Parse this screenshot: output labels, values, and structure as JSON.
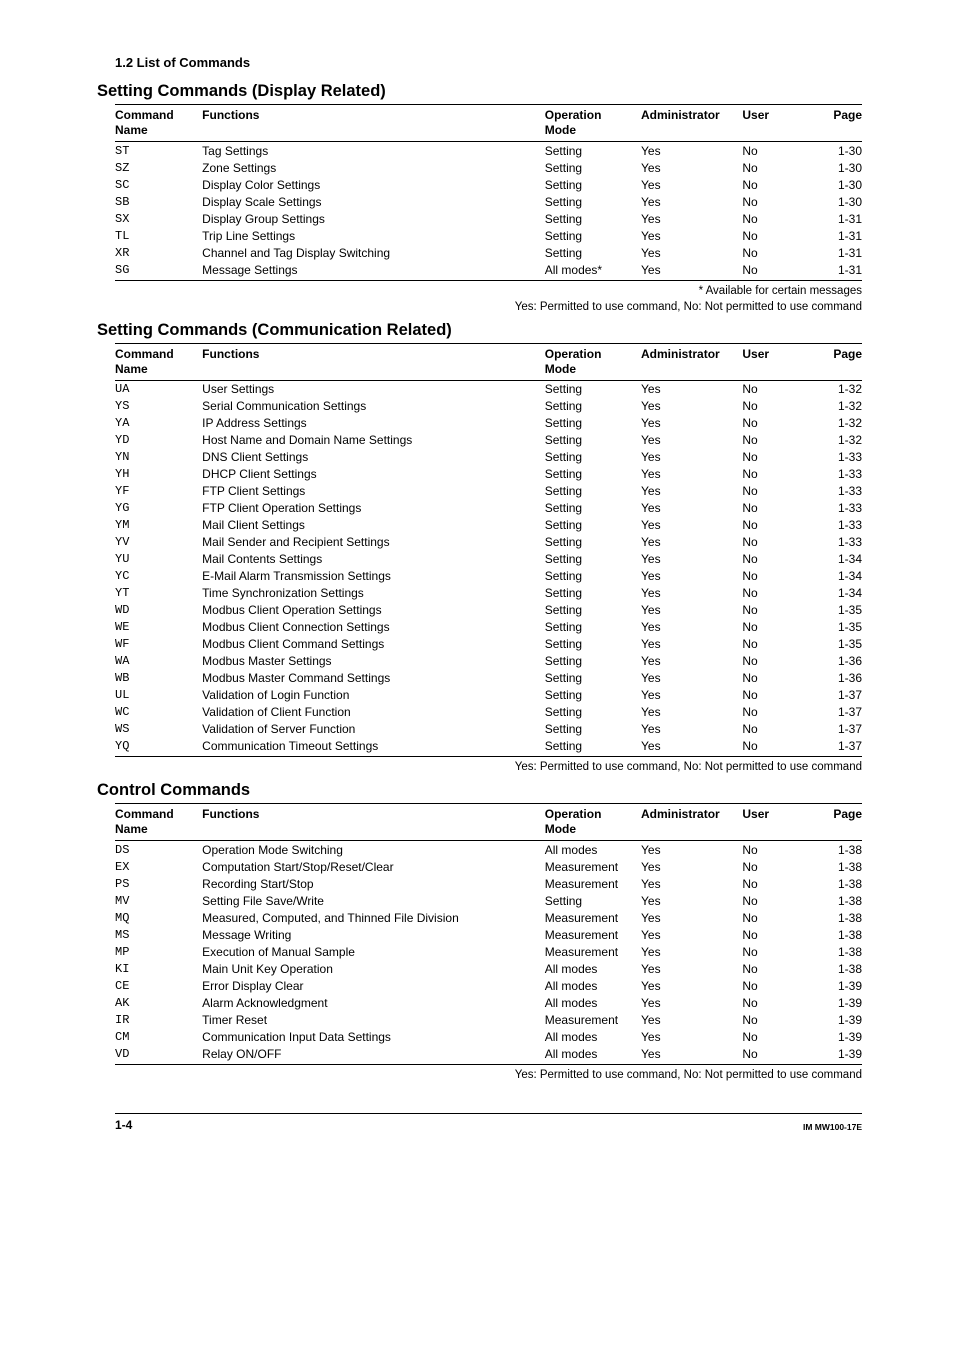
{
  "topHeading": "1.2  List of Commands",
  "sections": [
    {
      "title": "Setting Commands (Display Related)",
      "rows": [
        {
          "name": "ST",
          "func": "Tag Settings",
          "op": "Setting",
          "admin": "Yes",
          "user": "No",
          "page": "1-30"
        },
        {
          "name": "SZ",
          "func": "Zone Settings",
          "op": "Setting",
          "admin": "Yes",
          "user": "No",
          "page": "1-30"
        },
        {
          "name": "SC",
          "func": "Display Color Settings",
          "op": "Setting",
          "admin": "Yes",
          "user": "No",
          "page": "1-30"
        },
        {
          "name": "SB",
          "func": "Display Scale Settings",
          "op": "Setting",
          "admin": "Yes",
          "user": "No",
          "page": "1-30"
        },
        {
          "name": "SX",
          "func": "Display Group Settings",
          "op": "Setting",
          "admin": "Yes",
          "user": "No",
          "page": "1-31"
        },
        {
          "name": "TL",
          "func": "Trip Line Settings",
          "op": "Setting",
          "admin": "Yes",
          "user": "No",
          "page": "1-31"
        },
        {
          "name": "XR",
          "func": "Channel and Tag Display Switching",
          "op": "Setting",
          "admin": "Yes",
          "user": "No",
          "page": "1-31"
        },
        {
          "name": "SG",
          "func": "Message Settings",
          "op": "All modes*",
          "admin": "Yes",
          "user": "No",
          "page": "1-31"
        }
      ],
      "notes": [
        "* Available for certain messages",
        "Yes: Permitted to use command, No: Not permitted to use command"
      ]
    },
    {
      "title": "Setting Commands (Communication Related)",
      "rows": [
        {
          "name": "UA",
          "func": "User Settings",
          "op": "Setting",
          "admin": "Yes",
          "user": "No",
          "page": "1-32"
        },
        {
          "name": "YS",
          "func": "Serial Communication Settings",
          "op": "Setting",
          "admin": "Yes",
          "user": "No",
          "page": "1-32"
        },
        {
          "name": "YA",
          "func": "IP Address Settings",
          "op": "Setting",
          "admin": "Yes",
          "user": "No",
          "page": "1-32"
        },
        {
          "name": "YD",
          "func": "Host Name and Domain Name Settings",
          "op": "Setting",
          "admin": "Yes",
          "user": "No",
          "page": "1-32"
        },
        {
          "name": "YN",
          "func": "DNS Client Settings",
          "op": "Setting",
          "admin": "Yes",
          "user": "No",
          "page": "1-33"
        },
        {
          "name": "YH",
          "func": "DHCP Client Settings",
          "op": "Setting",
          "admin": "Yes",
          "user": "No",
          "page": "1-33"
        },
        {
          "name": "YF",
          "func": "FTP Client Settings",
          "op": "Setting",
          "admin": "Yes",
          "user": "No",
          "page": "1-33"
        },
        {
          "name": "YG",
          "func": "FTP Client Operation Settings",
          "op": "Setting",
          "admin": "Yes",
          "user": "No",
          "page": "1-33"
        },
        {
          "name": "YM",
          "func": "Mail Client Settings",
          "op": "Setting",
          "admin": "Yes",
          "user": "No",
          "page": "1-33"
        },
        {
          "name": "YV",
          "func": "Mail Sender and Recipient Settings",
          "op": "Setting",
          "admin": "Yes",
          "user": "No",
          "page": "1-33"
        },
        {
          "name": "YU",
          "func": "Mail Contents Settings",
          "op": "Setting",
          "admin": "Yes",
          "user": "No",
          "page": "1-34"
        },
        {
          "name": "YC",
          "func": "E-Mail Alarm Transmission Settings",
          "op": "Setting",
          "admin": "Yes",
          "user": "No",
          "page": "1-34"
        },
        {
          "name": "YT",
          "func": "Time Synchronization Settings",
          "op": "Setting",
          "admin": "Yes",
          "user": "No",
          "page": "1-34"
        },
        {
          "name": "WD",
          "func": "Modbus Client Operation Settings",
          "op": "Setting",
          "admin": "Yes",
          "user": "No",
          "page": "1-35"
        },
        {
          "name": "WE",
          "func": "Modbus Client Connection Settings",
          "op": "Setting",
          "admin": "Yes",
          "user": "No",
          "page": "1-35"
        },
        {
          "name": "WF",
          "func": "Modbus Client Command Settings",
          "op": "Setting",
          "admin": "Yes",
          "user": "No",
          "page": "1-35"
        },
        {
          "name": "WA",
          "func": "Modbus Master Settings",
          "op": "Setting",
          "admin": "Yes",
          "user": "No",
          "page": "1-36"
        },
        {
          "name": "WB",
          "func": "Modbus Master Command Settings",
          "op": "Setting",
          "admin": "Yes",
          "user": "No",
          "page": "1-36"
        },
        {
          "name": "UL",
          "func": "Validation of Login Function",
          "op": "Setting",
          "admin": "Yes",
          "user": "No",
          "page": "1-37"
        },
        {
          "name": "WC",
          "func": "Validation of Client Function",
          "op": "Setting",
          "admin": "Yes",
          "user": "No",
          "page": "1-37"
        },
        {
          "name": "WS",
          "func": "Validation of Server Function",
          "op": "Setting",
          "admin": "Yes",
          "user": "No",
          "page": "1-37"
        },
        {
          "name": "YQ",
          "func": "Communication Timeout Settings",
          "op": "Setting",
          "admin": "Yes",
          "user": "No",
          "page": "1-37"
        }
      ],
      "notes": [
        "Yes: Permitted to use command, No: Not permitted to use command"
      ]
    },
    {
      "title": "Control Commands",
      "rows": [
        {
          "name": "DS",
          "func": "Operation Mode Switching",
          "op": "All modes",
          "admin": "Yes",
          "user": "No",
          "page": "1-38"
        },
        {
          "name": "EX",
          "func": "Computation Start/Stop/Reset/Clear",
          "op": "Measurement",
          "admin": "Yes",
          "user": "No",
          "page": "1-38"
        },
        {
          "name": "PS",
          "func": "Recording Start/Stop",
          "op": "Measurement",
          "admin": "Yes",
          "user": "No",
          "page": "1-38"
        },
        {
          "name": "MV",
          "func": "Setting File Save/Write",
          "op": "Setting",
          "admin": "Yes",
          "user": "No",
          "page": "1-38"
        },
        {
          "name": "MQ",
          "func": "Measured, Computed, and Thinned File Division",
          "op": "Measurement",
          "admin": "Yes",
          "user": "No",
          "page": "1-38"
        },
        {
          "name": "MS",
          "func": "Message Writing",
          "op": "Measurement",
          "admin": "Yes",
          "user": "No",
          "page": "1-38"
        },
        {
          "name": "MP",
          "func": "Execution of Manual Sample",
          "op": "Measurement",
          "admin": "Yes",
          "user": "No",
          "page": "1-38"
        },
        {
          "name": "KI",
          "func": "Main Unit Key Operation",
          "op": "All modes",
          "admin": "Yes",
          "user": "No",
          "page": "1-38"
        },
        {
          "name": "CE",
          "func": "Error Display Clear",
          "op": "All modes",
          "admin": "Yes",
          "user": "No",
          "page": "1-39"
        },
        {
          "name": "AK",
          "func": "Alarm Acknowledgment",
          "op": "All modes",
          "admin": "Yes",
          "user": "No",
          "page": "1-39"
        },
        {
          "name": "IR",
          "func": "Timer Reset",
          "op": "Measurement",
          "admin": "Yes",
          "user": "No",
          "page": "1-39"
        },
        {
          "name": "CM",
          "func": "Communication Input Data Settings",
          "op": "All modes",
          "admin": "Yes",
          "user": "No",
          "page": "1-39"
        },
        {
          "name": "VD",
          "func": "Relay ON/OFF",
          "op": "All modes",
          "admin": "Yes",
          "user": "No",
          "page": "1-39"
        }
      ],
      "notes": [
        "Yes: Permitted to use command, No: Not permitted to use command"
      ]
    }
  ],
  "headers": {
    "name": "Command Name",
    "func": "Functions",
    "op": "Operation Mode",
    "admin": "Administrator",
    "user": "User",
    "page": "Page"
  },
  "footer": {
    "pageNum": "1-4",
    "docCode": "IM MW100-17E"
  }
}
